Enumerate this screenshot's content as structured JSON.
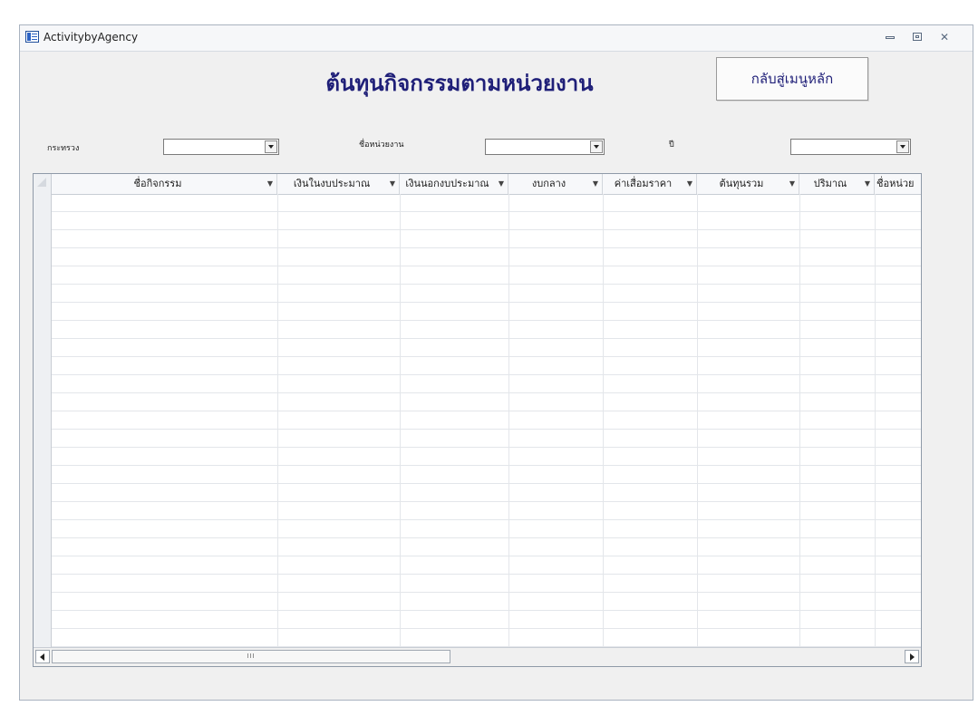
{
  "window": {
    "title": "ActivitybyAgency",
    "close_glyph": "✕"
  },
  "form": {
    "heading": "ต้นทุนกิจกรรมตามหน่วยงาน",
    "back_button": "กลับสู่เมนูหลัก"
  },
  "filters": [
    {
      "label": "กระทรวง",
      "value": ""
    },
    {
      "label": "ชื่อหน่วยงาน",
      "value": ""
    },
    {
      "label": "ปี",
      "value": ""
    }
  ],
  "grid": {
    "columns": [
      {
        "label": "ชื่อกิจกรรม"
      },
      {
        "label": "เงินในงบประมาณ"
      },
      {
        "label": "เงินนอกงบประมาณ"
      },
      {
        "label": "งบกลาง"
      },
      {
        "label": "ค่าเสื่อมราคา"
      },
      {
        "label": "ต้นทุนรวม"
      },
      {
        "label": "ปริมาณ"
      },
      {
        "label": "ชื่อหน่วย"
      }
    ],
    "rows": [],
    "scroll_thumb_glyph": "III"
  }
}
